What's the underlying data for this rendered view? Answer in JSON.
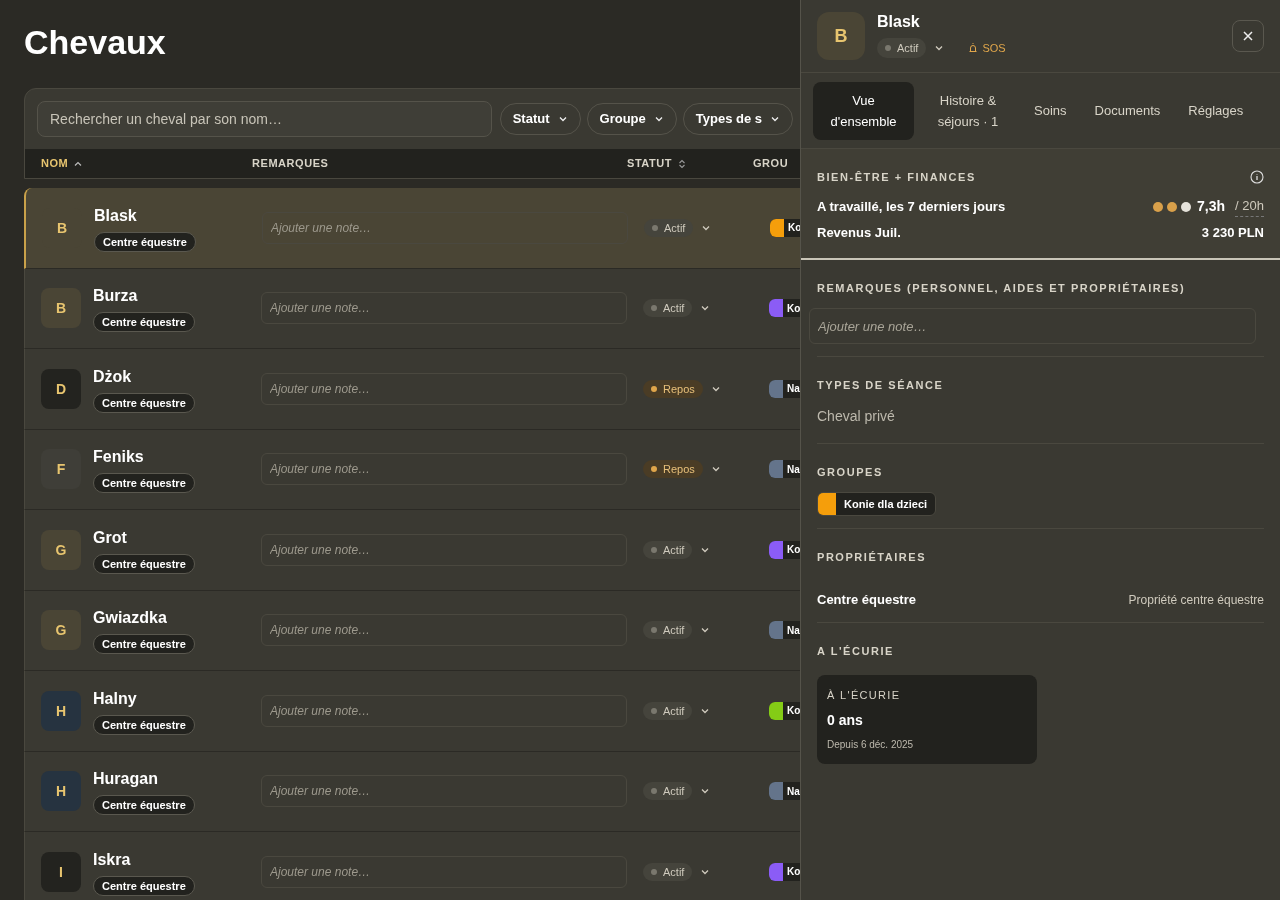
{
  "page_title": "Chevaux",
  "filters": {
    "search_placeholder": "Rechercher un cheval par son nom…",
    "buttons": [
      "Statut",
      "Groupe",
      "Types de s"
    ]
  },
  "table": {
    "columns": [
      {
        "label": "NOM",
        "sorted": true,
        "sortable": false
      },
      {
        "label": "REMARQUES",
        "sorted": false,
        "sortable": false
      },
      {
        "label": "STATUT",
        "sorted": false,
        "sortable": true
      },
      {
        "label": "GROU",
        "sorted": false,
        "sortable": false
      }
    ],
    "rows": [
      {
        "initial": "B",
        "name": "Blask",
        "color": "#4a4535",
        "owner": "Centre équestre",
        "note_placeholder": "Ajouter une note…",
        "status": {
          "label": "Actif",
          "kind": "active"
        },
        "group": {
          "label": "Ko",
          "color": "#f59e0b"
        },
        "selected": true
      },
      {
        "initial": "B",
        "name": "Burza",
        "color": "#4a4535",
        "owner": "Centre équestre",
        "note_placeholder": "Ajouter une note…",
        "status": {
          "label": "Actif",
          "kind": "active"
        },
        "group": {
          "label": "Ko",
          "color": "#8b5cf6"
        },
        "selected": false
      },
      {
        "initial": "D",
        "name": "Dżok",
        "color": "#23231f",
        "owner": "Centre équestre",
        "note_placeholder": "Ajouter une note…",
        "status": {
          "label": "Repos",
          "kind": "rest"
        },
        "group": {
          "label": "Na",
          "color": "#64748b"
        },
        "selected": false
      },
      {
        "initial": "F",
        "name": "Feniks",
        "color": "#3f3e38",
        "owner": "Centre équestre",
        "note_placeholder": "Ajouter une note…",
        "status": {
          "label": "Repos",
          "kind": "rest"
        },
        "group": {
          "label": "Na",
          "color": "#64748b"
        },
        "selected": false
      },
      {
        "initial": "G",
        "name": "Grot",
        "color": "#4a4535",
        "owner": "Centre équestre",
        "note_placeholder": "Ajouter une note…",
        "status": {
          "label": "Actif",
          "kind": "active"
        },
        "group": {
          "label": "Ko",
          "color": "#8b5cf6"
        },
        "selected": false
      },
      {
        "initial": "G",
        "name": "Gwiazdka",
        "color": "#4a4535",
        "owner": "Centre équestre",
        "note_placeholder": "Ajouter une note…",
        "status": {
          "label": "Actif",
          "kind": "active"
        },
        "group": {
          "label": "Na",
          "color": "#64748b"
        },
        "selected": false
      },
      {
        "initial": "H",
        "name": "Halny",
        "color": "#263340",
        "owner": "Centre équestre",
        "note_placeholder": "Ajouter une note…",
        "status": {
          "label": "Actif",
          "kind": "active"
        },
        "group": {
          "label": "Ko",
          "color": "#84cc16"
        },
        "selected": false
      },
      {
        "initial": "H",
        "name": "Huragan",
        "color": "#263340",
        "owner": "Centre équestre",
        "note_placeholder": "Ajouter une note…",
        "status": {
          "label": "Actif",
          "kind": "active"
        },
        "group": {
          "label": "Na",
          "color": "#64748b"
        },
        "selected": false
      },
      {
        "initial": "I",
        "name": "Iskra",
        "color": "#23231f",
        "owner": "Centre équestre",
        "note_placeholder": "Ajouter une note…",
        "status": {
          "label": "Actif",
          "kind": "active"
        },
        "group": {
          "label": "Ko",
          "color": "#8b5cf6"
        },
        "selected": false
      }
    ]
  },
  "panel": {
    "initial": "B",
    "name": "Blask",
    "status": {
      "label": "Actif",
      "kind": "active"
    },
    "sos": "SOS",
    "tabs": [
      {
        "label": "Vue d'ensemble",
        "selected": true
      },
      {
        "label": "Histoire & séjours · 1",
        "selected": false
      },
      {
        "label": "Soins",
        "selected": false
      },
      {
        "label": "Documents",
        "selected": false
      },
      {
        "label": "Réglages",
        "selected": false
      }
    ],
    "wellbeing": {
      "title": "BIEN-ÊTRE + FINANCES",
      "worked_label": "A travaillé, les 7 derniers jours",
      "stars": 2,
      "worked_value": "7,3h",
      "worked_target": "/ 20h",
      "revenue_label": "Revenus Juil.",
      "revenue_value": "3 230 PLN"
    },
    "remarks": {
      "title": "REMARQUES **(PERSONNEL, AIDES ET PROPRIÉTAIRES)**",
      "placeholder": "Ajouter une note…"
    },
    "session_types": {
      "title": "TYPES DE SÉANCE",
      "value": "Cheval privé"
    },
    "groups": {
      "title": "GROUPES",
      "items": [
        {
          "label": "Konie dla dzieci",
          "color": "#f59e0b"
        }
      ]
    },
    "owners": {
      "title": "PROPRIÉTAIRES",
      "items": [
        {
          "name": "Centre équestre",
          "detail": "Propriété centre équestre"
        }
      ]
    },
    "stable": {
      "title": "A L'ÉCURIE",
      "card_label": "À L'ÉCURIE",
      "card_value": "0 ans",
      "card_since": "Depuis 6 déc. 2025"
    }
  }
}
